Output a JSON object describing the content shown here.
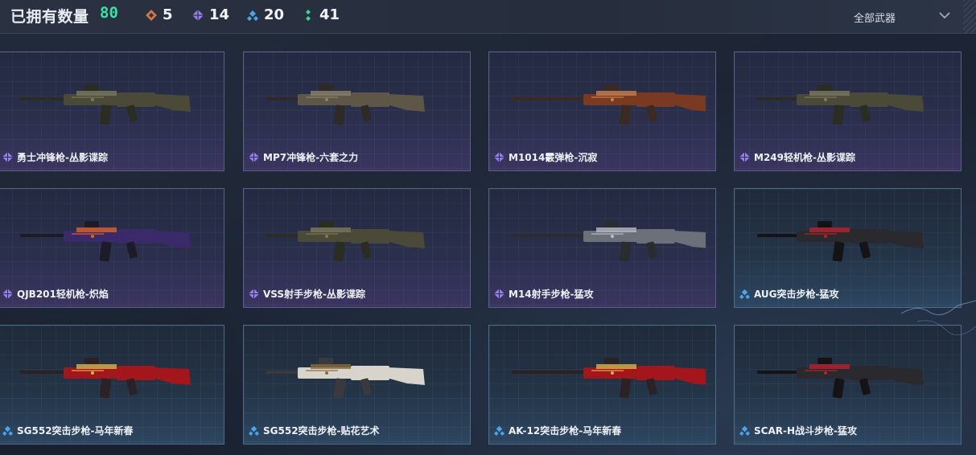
{
  "header": {
    "owned_label": "已拥有数量",
    "owned_count": "80",
    "stats": [
      {
        "icon": "orange-diamond-icon",
        "color": "#d2734a",
        "value": "5"
      },
      {
        "icon": "purple-diamond-icon",
        "color": "#9c7ef0",
        "value": "14"
      },
      {
        "icon": "blue-diamond-icon",
        "color": "#4fa3e8",
        "value": "20"
      },
      {
        "icon": "green-diamond-icon",
        "color": "#3fd39a",
        "value": "41"
      }
    ],
    "filter_label": "全部武器"
  },
  "colors": {
    "owned_count": "#3fe0a5",
    "purple_rarity": "#9c7ef0",
    "blue_rarity": "#4fa3e8"
  },
  "weapons": [
    {
      "name": "勇士冲锋枪-丛影谍踪",
      "rarity": "purple",
      "skin": "camo"
    },
    {
      "name": "MP7冲锋枪-六套之力",
      "rarity": "purple",
      "skin": "sand"
    },
    {
      "name": "M1014霰弹枪-沉寂",
      "rarity": "purple",
      "skin": "copper"
    },
    {
      "name": "M249轻机枪-丛影谍踪",
      "rarity": "purple",
      "skin": "camo"
    },
    {
      "name": "QJB201轻机枪-炽焰",
      "rarity": "purple",
      "skin": "flame"
    },
    {
      "name": "VSS射手步枪-丛影谍踪",
      "rarity": "purple",
      "skin": "camo"
    },
    {
      "name": "M14射手步枪-猛攻",
      "rarity": "purple",
      "skin": "steel"
    },
    {
      "name": "AUG突击步枪-猛攻",
      "rarity": "blue",
      "skin": "redblack"
    },
    {
      "name": "SG552突击步枪-马年新春",
      "rarity": "blue",
      "skin": "red"
    },
    {
      "name": "SG552突击步枪-贴花艺术",
      "rarity": "blue",
      "skin": "white"
    },
    {
      "name": "AK-12突击步枪-马年新春",
      "rarity": "blue",
      "skin": "red"
    },
    {
      "name": "SCAR-H战斗步枪-猛攻",
      "rarity": "blue",
      "skin": "redblack"
    }
  ]
}
